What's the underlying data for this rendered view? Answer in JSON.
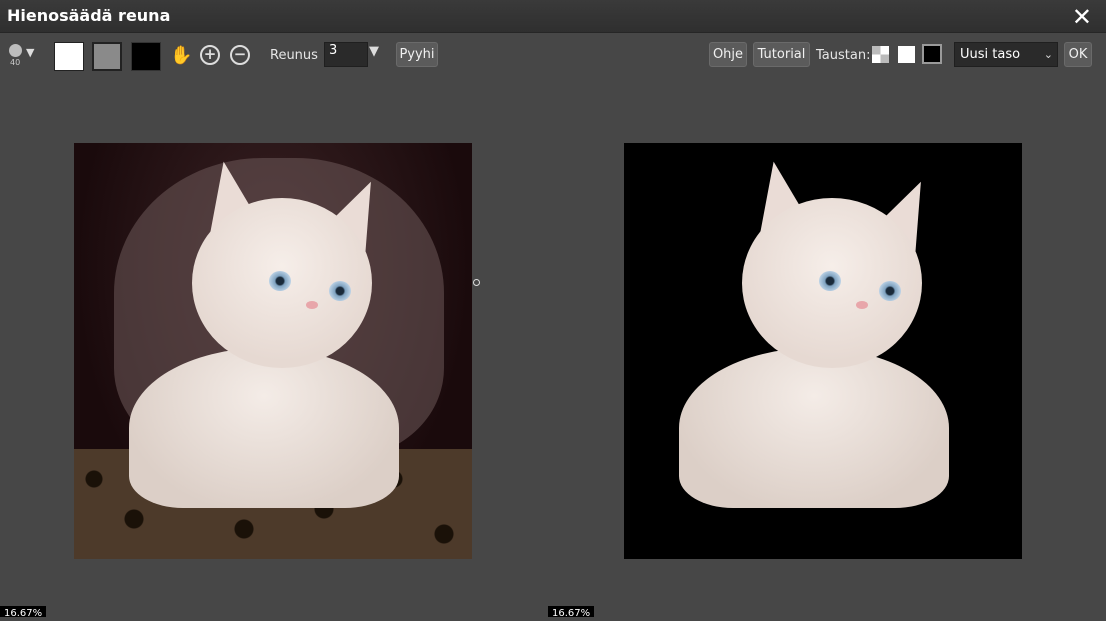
{
  "window": {
    "title": "Hienosäädä reuna",
    "close_glyph": "✕"
  },
  "toolbar": {
    "brush_size": "40",
    "brush_arrow": "▼",
    "hand_glyph": "✋",
    "zoom_in_glyph": "+",
    "zoom_out_glyph": "−",
    "edge_label": "Reunus",
    "edge_value": "3",
    "edge_arrow": "▼",
    "clear_label": "Pyyhi",
    "help_label": "Ohje",
    "tutorial_label": "Tutorial",
    "background_label": "Taustan:",
    "output_select": "Uusi taso",
    "select_chevron": "⌄",
    "ok_label": "OK"
  },
  "colors": {
    "swatch_white": "#ffffff",
    "swatch_gray": "#8a8a8a",
    "swatch_black": "#000000"
  },
  "canvas": {
    "left_zoom": "16.67%",
    "right_zoom": "16.67%"
  }
}
